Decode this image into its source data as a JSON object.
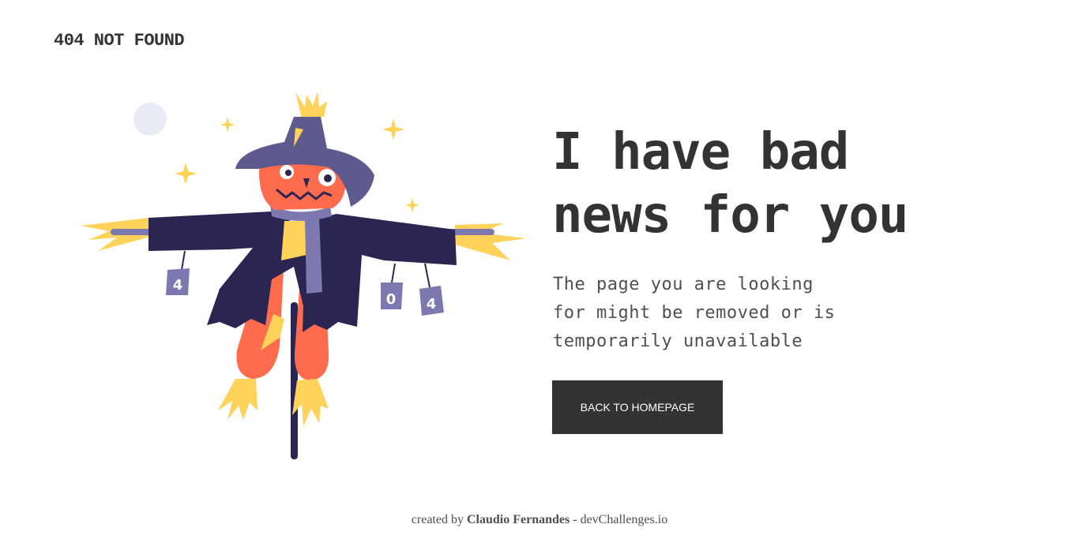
{
  "header": {
    "brand": "404 NOT FOUND"
  },
  "illustration": {
    "description_icon": "scarecrow-illustration",
    "cans": [
      "4",
      "0",
      "4"
    ]
  },
  "main": {
    "headline_lines": [
      "I have bad",
      "news for you"
    ],
    "message_lines": [
      "The page you are looking",
      "for might be removed or is",
      "temporarily unavailable"
    ],
    "button_label": "BACK TO HOMEPAGE"
  },
  "footer": {
    "prefix": "created by",
    "author": "Claudio Fernandes",
    "separator": "-",
    "site": "devChallenges.io"
  },
  "colors": {
    "text": "#333333",
    "button_bg": "#333333",
    "hat": "#5f5a8d",
    "coat": "#2b2552",
    "face": "#ff6b4d",
    "straw": "#ffd25a",
    "moon": "#e8eaf6"
  }
}
